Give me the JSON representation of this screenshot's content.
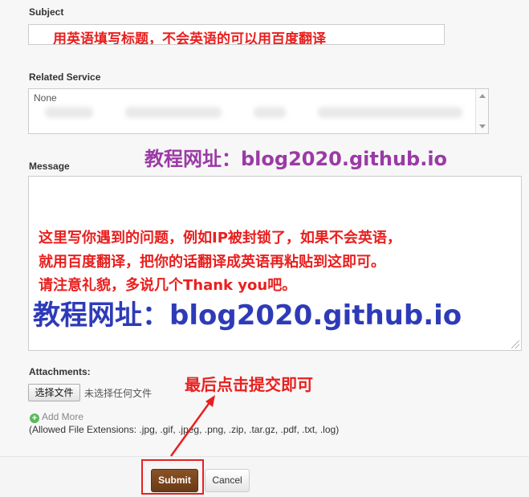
{
  "subject": {
    "label": "Subject",
    "value": "用英语填写标题，不会英语的可以用百度翻译"
  },
  "related_service": {
    "label": "Related Service",
    "selected": "None"
  },
  "tutorial_small": "教程网址：blog2020.github.io",
  "message": {
    "label": "Message",
    "lines": [
      "这里写你遇到的问题，例如IP被封锁了，如果不会英语，",
      "就用百度翻译，把你的话翻译成英语再粘贴到这即可。",
      "请注意礼貌，多说几个Thank you吧。"
    ],
    "tutorial_big": "教程网址：blog2020.github.io"
  },
  "attachments": {
    "label": "Attachments:",
    "choose_file": "选择文件",
    "no_file": "未选择任何文件",
    "add_more": "Add More",
    "allowed": "(Allowed File Extensions: .jpg, .gif, .jpeg, .png, .zip, .tar.gz, .pdf, .txt, .log)"
  },
  "annotation": "最后点击提交即可",
  "buttons": {
    "submit": "Submit",
    "cancel": "Cancel"
  },
  "colors": {
    "annotation_red": "#e8201f",
    "tutorial_purple": "#9b3aa6",
    "tutorial_blue": "#2e3bb8",
    "submit_brown": "#7a4520"
  }
}
